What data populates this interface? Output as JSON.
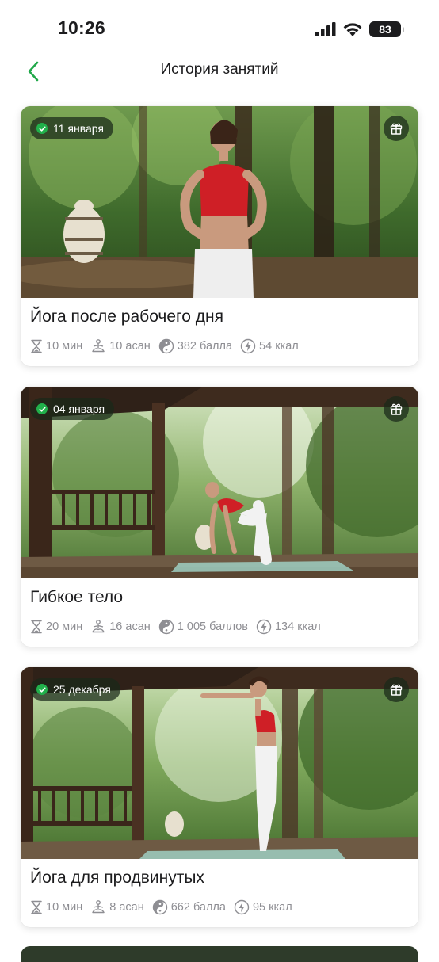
{
  "status_bar": {
    "time": "10:26",
    "battery": "83"
  },
  "header": {
    "title": "История занятий",
    "back_icon": "chevron-left-icon",
    "accent_color": "#21a84a"
  },
  "cards": [
    {
      "date": "11 января",
      "title": "Йога после рабочего дня",
      "duration": "10 мин",
      "asanas": "10 асан",
      "points": "382 балла",
      "calories": "54 ккал"
    },
    {
      "date": "04 января",
      "title": "Гибкое тело",
      "duration": "20 мин",
      "asanas": "16 асан",
      "points": "1 005 баллов",
      "calories": "134 ккал"
    },
    {
      "date": "25 декабря",
      "title": "Йога для продвинутых",
      "duration": "10 мин",
      "asanas": "8 асан",
      "points": "662 балла",
      "calories": "95 ккал"
    }
  ],
  "icons": {
    "completed": "check-circle-icon",
    "gift": "gift-icon",
    "duration": "hourglass-icon",
    "asanas": "meditation-icon",
    "points": "yin-yang-icon",
    "calories": "energy-icon"
  }
}
